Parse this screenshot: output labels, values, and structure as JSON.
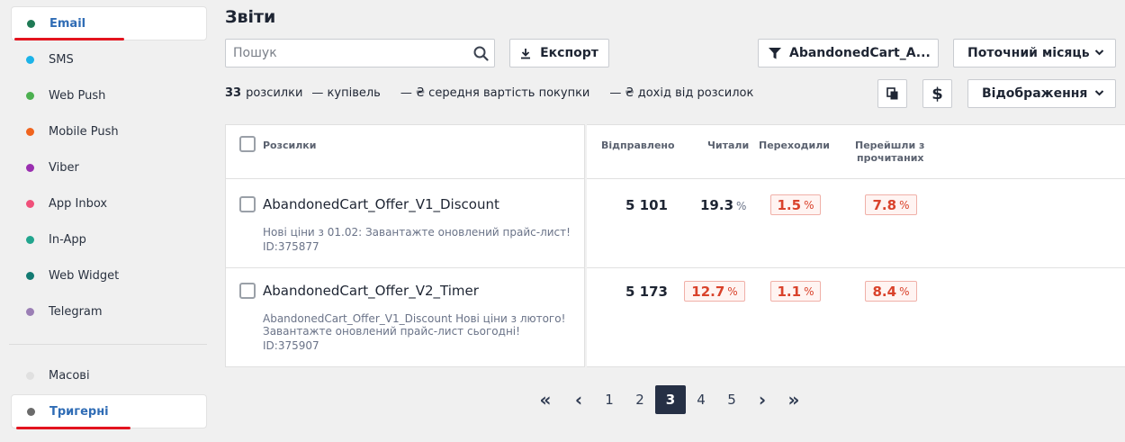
{
  "sidebar": {
    "items": [
      {
        "label": "Email",
        "color": "#1f7a55",
        "active": true
      },
      {
        "label": "SMS",
        "color": "#1cb3e8",
        "active": false
      },
      {
        "label": "Web Push",
        "color": "#4cb050",
        "active": false
      },
      {
        "label": "Mobile Push",
        "color": "#f0641e",
        "active": false
      },
      {
        "label": "Viber",
        "color": "#9a2fb0",
        "active": false
      },
      {
        "label": "App Inbox",
        "color": "#f0507a",
        "active": false
      },
      {
        "label": "In-App",
        "color": "#22a58e",
        "active": false
      },
      {
        "label": "Web Widget",
        "color": "#137a72",
        "active": false
      },
      {
        "label": "Telegram",
        "color": "#9b7fb5",
        "active": false
      }
    ],
    "types": [
      {
        "label": "Масові",
        "color": "#e0e0e0",
        "active": false
      },
      {
        "label": "Тригерні",
        "color": "#6b6b6b",
        "active": true
      }
    ]
  },
  "header": {
    "title": "Звіти",
    "search_placeholder": "Пошук",
    "export_label": "Експорт",
    "filter_label": "AbandonedCart_A...",
    "period_label": "Поточний місяць",
    "view_label": "Відображення",
    "currency_symbol": "$"
  },
  "summary": {
    "count": "33",
    "count_label": "розсилки",
    "purchases": "— купівель",
    "avg_value": "— ₴ середня вартість покупки",
    "revenue": "— ₴ дохід від розсилок"
  },
  "table": {
    "columns": {
      "campaigns": "Розсилки",
      "sent": "Відправлено",
      "read": "Читали",
      "clicked": "Переходили",
      "clicked_of_read_1": "Перейшли з",
      "clicked_of_read_2": "прочитаних"
    },
    "rows": [
      {
        "name": "AbandonedCart_Offer_V1_Discount",
        "desc1": "Нові ціни з 01.02: Завантажте оновлений прайс-лист!",
        "desc2": "",
        "id": "ID:375877",
        "sent": "5 101",
        "read": "19.3",
        "clicked": "1.5",
        "clicked_of_read": "7.8",
        "pct_unit": "%"
      },
      {
        "name": "AbandonedCart_Offer_V2_Timer",
        "desc1": "AbandonedCart_Offer_V1_Discount Нові ціни з лютого!",
        "desc2": "Завантажте оновлений прайс-лист сьогодні!",
        "id": "ID:375907",
        "sent": "5 173",
        "read": "12.7",
        "clicked": "1.1",
        "clicked_of_read": "8.4",
        "pct_unit": "%"
      }
    ]
  },
  "pagination": {
    "first": "«",
    "prev": "‹",
    "pages": [
      "1",
      "2",
      "3",
      "4",
      "5"
    ],
    "current": "3",
    "next": "›",
    "last": "»"
  },
  "colors": {
    "accent_underline": "#e3141f",
    "highlight_text": "#d9422b",
    "pager_active": "#263045"
  }
}
